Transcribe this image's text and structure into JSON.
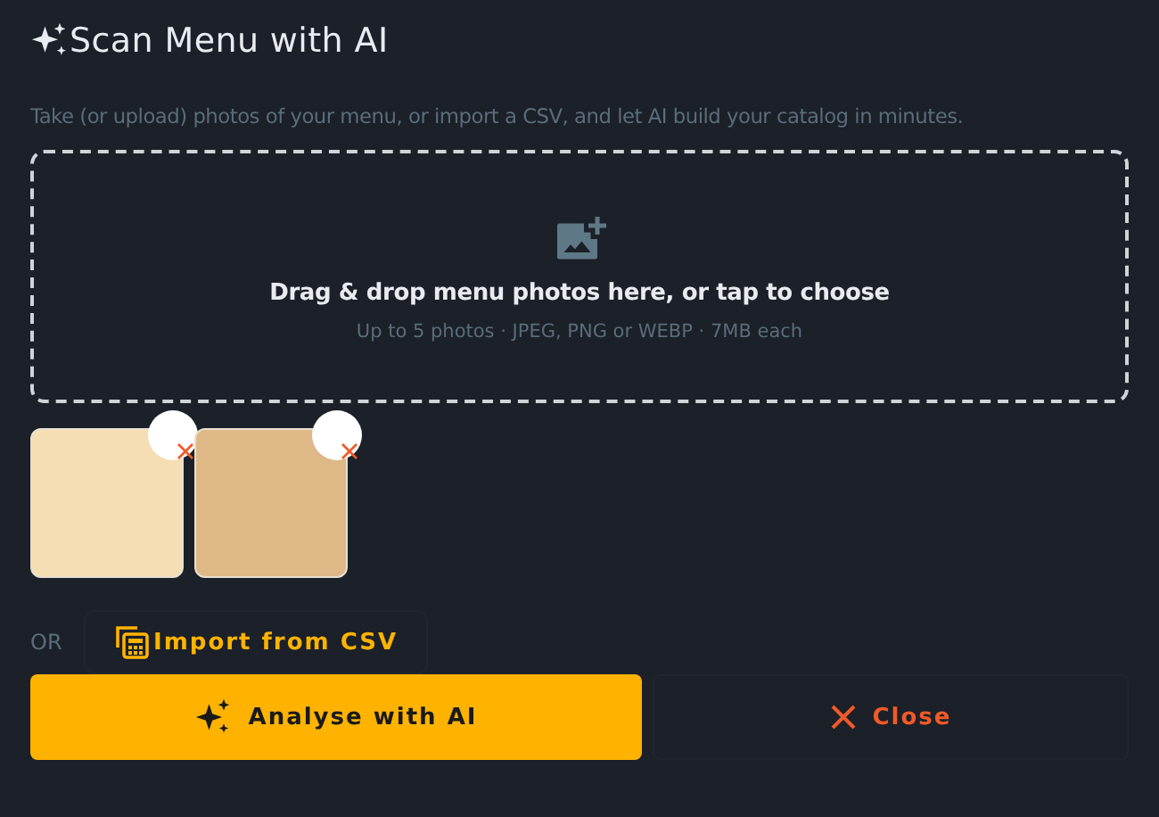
{
  "dialog": {
    "title": "Scan Menu with AI",
    "subtitle": "Take (or upload) photos of your menu, or import a CSV, and let AI build your catalog in minutes."
  },
  "dropzone": {
    "title": "Drag & drop menu photos here, or tap to choose",
    "hint": "Up to 5 photos · JPEG, PNG or WEBP · 7MB each"
  },
  "photos": [
    {
      "color": "#f5deb3"
    },
    {
      "color": "#deb887"
    }
  ],
  "import": {
    "separator": "OR",
    "label": "Import from CSV"
  },
  "buttons": [
    {
      "kind": "primary",
      "label": "Analyse with AI"
    },
    {
      "kind": "close",
      "label": "Close"
    }
  ]
}
